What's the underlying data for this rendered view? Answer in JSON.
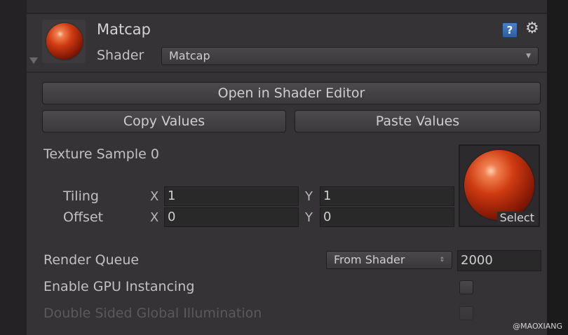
{
  "material": {
    "name": "Matcap",
    "shader_label": "Shader",
    "shader_value": "Matcap",
    "help_icon": "help-icon",
    "settings_icon": "gear-icon"
  },
  "buttons": {
    "open_editor": "Open in Shader Editor",
    "copy_values": "Copy Values",
    "paste_values": "Paste Values"
  },
  "texture": {
    "label": "Texture Sample 0",
    "tiling_label": "Tiling",
    "offset_label": "Offset",
    "x_axis": "X",
    "y_axis": "Y",
    "tiling_x": "1",
    "tiling_y": "1",
    "offset_x": "0",
    "offset_y": "0",
    "select_label": "Select"
  },
  "render_queue": {
    "label": "Render Queue",
    "mode": "From Shader",
    "value": "2000"
  },
  "options": {
    "gpu_instancing": "Enable GPU Instancing",
    "double_sided_gi": "Double Sided Global Illumination"
  },
  "watermark": "@MAOXIANG",
  "colors": {
    "panel": "#353335",
    "accent_sphere": "#cf3b12",
    "help_blue": "#3d6fb4"
  }
}
